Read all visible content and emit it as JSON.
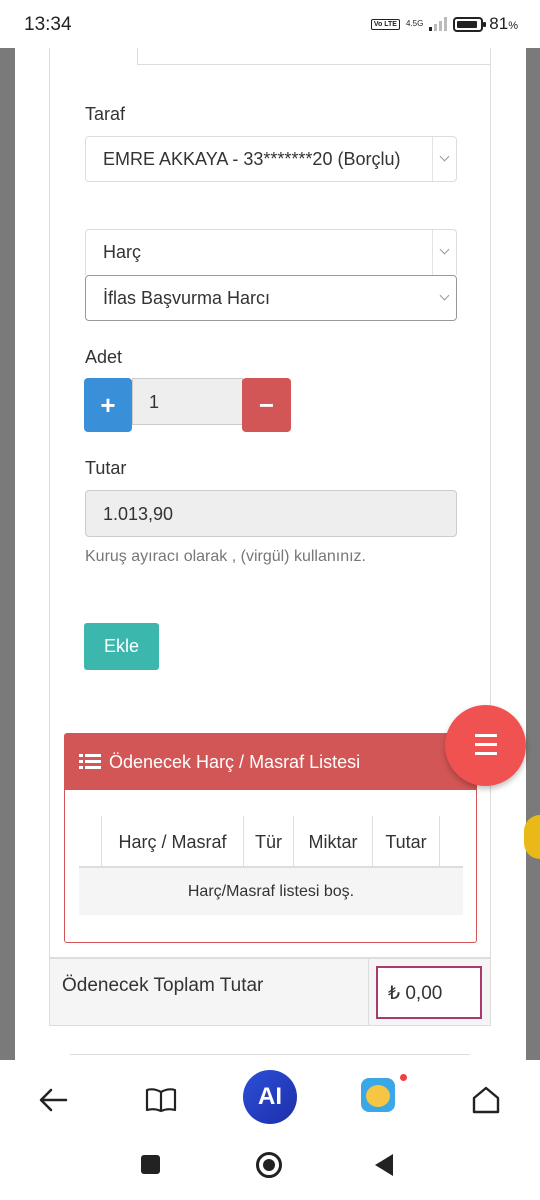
{
  "status_bar": {
    "time": "13:34",
    "volte": "Vo LTE",
    "network": "4.5G",
    "battery_percent": "81",
    "battery_suffix": "%"
  },
  "form": {
    "party_label": "Taraf",
    "party_value": "EMRE AKKAYA - 33*******20 (Borçlu)",
    "fee_type_value": "Harç",
    "fee_item_value": "İflas Başvurma Harcı",
    "quantity_label": "Adet",
    "plus_symbol": "+",
    "minus_symbol": "−",
    "quantity_value": "1",
    "amount_label": "Tutar",
    "amount_value": "1.013,90",
    "hint": "Kuruş ayıracı olarak , (virgül) kullanınız.",
    "add_button": "Ekle"
  },
  "list_panel": {
    "title": "Ödenecek Harç / Masraf Listesi",
    "columns": [
      "Harç / Masraf",
      "Tür",
      "Miktar",
      "Tutar"
    ],
    "empty_message": "Harç/Masraf listesi boş."
  },
  "total": {
    "label": "Ödenecek Toplam Tutar",
    "value": "₺ 0,00"
  },
  "colors": {
    "primary_blue": "#3a8fd9",
    "danger_red": "#d35656",
    "teal": "#3bb7ad",
    "fab_red": "#f05252",
    "total_border": "#a83a6e"
  },
  "browser_nav": {
    "ai_label": "AI",
    "icons": [
      "back-arrow-icon",
      "book-icon",
      "ai-assistant-icon",
      "game-icon",
      "home-icon"
    ]
  },
  "system_nav": {
    "icons": [
      "recent-apps-icon",
      "home-circle-icon",
      "back-triangle-icon"
    ]
  }
}
